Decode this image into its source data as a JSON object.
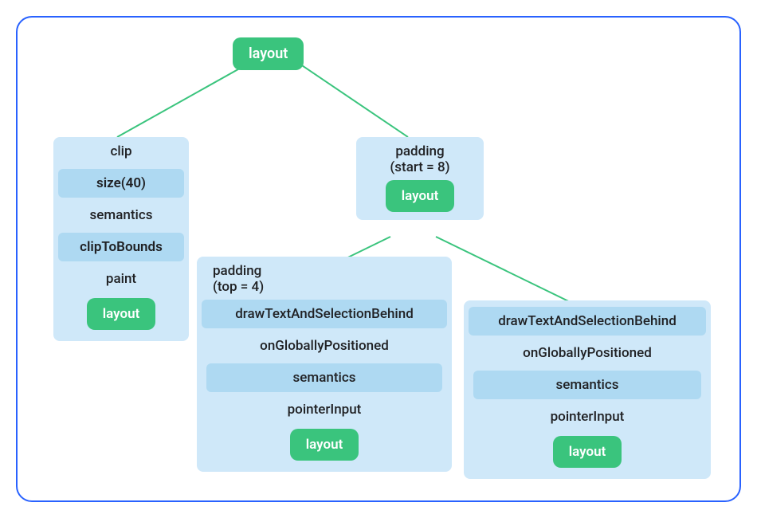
{
  "root": {
    "label": "layout"
  },
  "left": {
    "clip": "clip",
    "size": "size(40)",
    "semantics": "semantics",
    "clipToBounds": "clipToBounds",
    "paint": "paint",
    "layout": "layout"
  },
  "right": {
    "padding_line1": "padding",
    "padding_line2": "(start = 8)",
    "layout": "layout"
  },
  "bottomLeft": {
    "padding_line1": "padding",
    "padding_line2": "(top = 4)",
    "drawText": "drawTextAndSelectionBehind",
    "onGlobally": "onGloballyPositioned",
    "semantics": "semantics",
    "pointerInput": "pointerInput",
    "layout": "layout"
  },
  "bottomRight": {
    "drawText": "drawTextAndSelectionBehind",
    "onGlobally": "onGloballyPositioned",
    "semantics": "semantics",
    "pointerInput": "pointerInput",
    "layout": "layout"
  }
}
